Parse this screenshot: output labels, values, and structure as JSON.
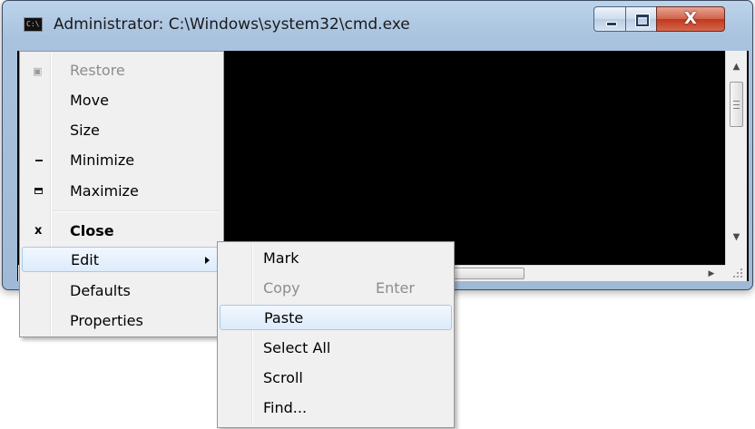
{
  "window": {
    "title": "Administrator: C:\\Windows\\system32\\cmd.exe",
    "icon": "cmd-icon",
    "icon_text": "C:\\",
    "close_glyph": "X"
  },
  "system_menu": {
    "items": [
      {
        "label": "Restore",
        "state": "disabled",
        "icon": "restore-icon"
      },
      {
        "label": "Move"
      },
      {
        "label": "Size"
      },
      {
        "label": "Minimize",
        "icon": "minimize-icon"
      },
      {
        "label": "Maximize",
        "icon": "maximize-icon"
      },
      {
        "label": "Close",
        "icon": "close-icon",
        "bold": true
      },
      {
        "label": "Edit",
        "state": "highlighted",
        "has_submenu": true
      },
      {
        "label": "Defaults"
      },
      {
        "label": "Properties"
      }
    ]
  },
  "edit_submenu": {
    "items": [
      {
        "label": "Mark"
      },
      {
        "label": "Copy",
        "state": "disabled",
        "shortcut": "Enter"
      },
      {
        "label": "Paste",
        "state": "highlighted"
      },
      {
        "label": "Select All"
      },
      {
        "label": "Scroll"
      },
      {
        "label": "Find..."
      }
    ]
  },
  "colors": {
    "console_background": "#000000",
    "menu_background": "#f0f0f0",
    "highlight_border": "#a8c8ec",
    "disabled_text": "#8d8d8d",
    "close_button": "#c0381d"
  }
}
